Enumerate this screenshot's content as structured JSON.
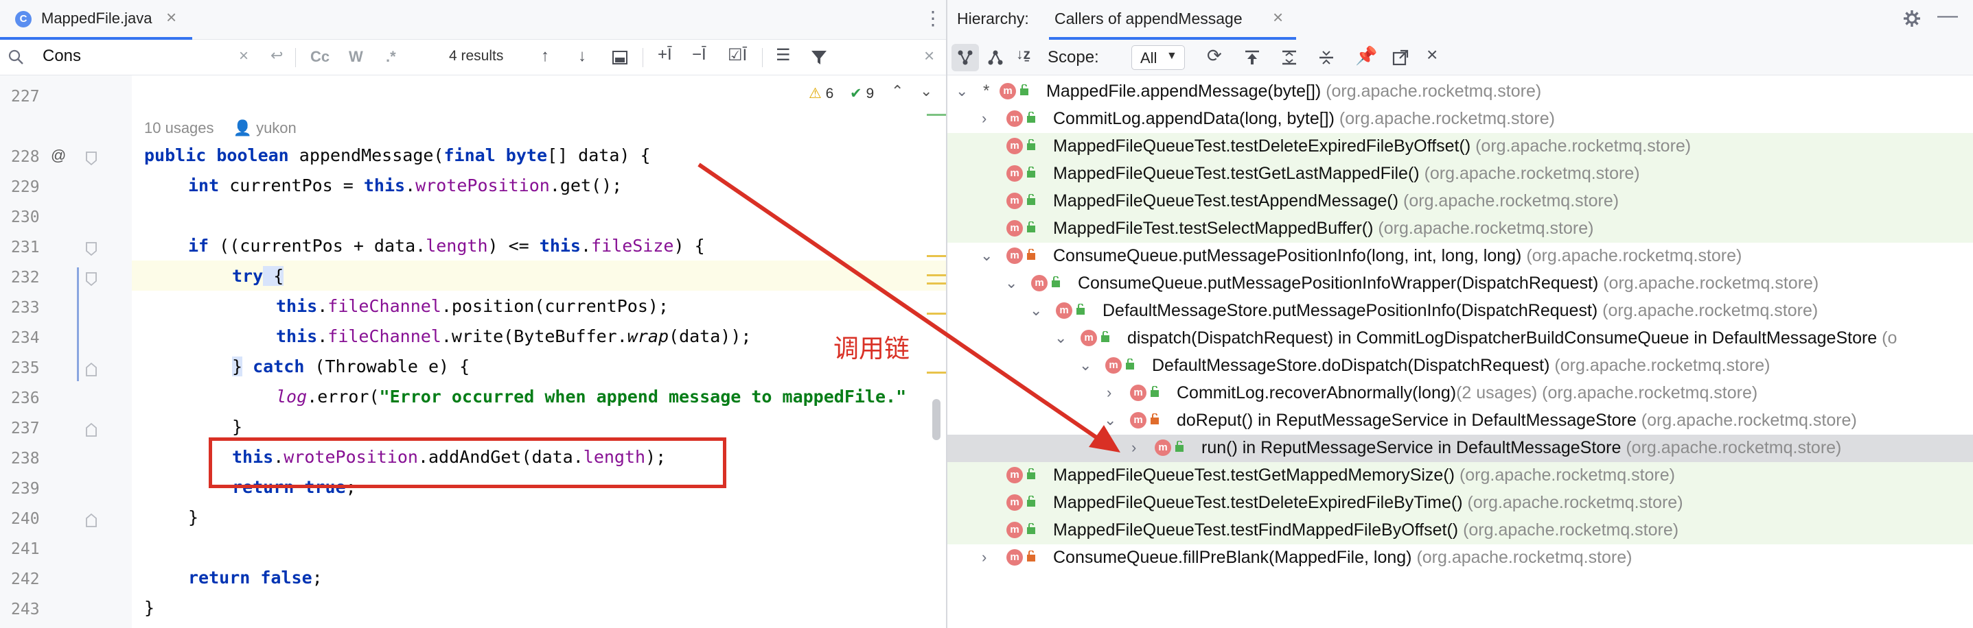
{
  "editor": {
    "tab_label": "MappedFile.java",
    "file_badge": "C",
    "find": {
      "query": "Cons",
      "results": "4 results",
      "cc": "Cc",
      "w": "W",
      "regex": ".*"
    },
    "inspections": {
      "warnings": "6",
      "ok": "9"
    },
    "hint": "10 usages",
    "author": "yukon",
    "lines": [
      "227",
      "228",
      "229",
      "230",
      "231",
      "232",
      "233",
      "234",
      "235",
      "236",
      "237",
      "238",
      "239",
      "240",
      "241",
      "242",
      "243"
    ],
    "code": {
      "l228_a": "public boolean",
      "l228_b": " appendMessage(",
      "l228_c": "final byte",
      "l228_d": "[] data) {",
      "l229_a": "int",
      "l229_b": " currentPos = ",
      "l229_c": "this",
      "l229_d": ".",
      "l229_e": "wrotePosition",
      "l229_f": ".get();",
      "l231_a": "if",
      "l231_b": " ((currentPos + data.",
      "l231_c": "length",
      "l231_d": ") <= ",
      "l231_e": "this",
      "l231_f": ".",
      "l231_g": "fileSize",
      "l231_h": ") {",
      "l232_a": "try",
      "l232_b": " {",
      "l233_a": "this",
      "l233_b": ".",
      "l233_c": "fileChannel",
      "l233_d": ".position(currentPos);",
      "l234_a": "this",
      "l234_b": ".",
      "l234_c": "fileChannel",
      "l234_d": ".write(ByteBuffer.",
      "l234_e": "wrap",
      "l234_f": "(data));",
      "l235_a": "}",
      "l235_b": " catch",
      "l235_c": " (Throwable e) {",
      "l236_a": "log",
      "l236_b": ".error(",
      "l236_c": "\"Error occurred when append message to mappedFile.\"",
      "l237": "}",
      "l238_a": "this",
      "l238_b": ".",
      "l238_c": "wrotePosition",
      "l238_d": ".addAndGet(data.",
      "l238_e": "length",
      "l238_f": ");",
      "l239_a": "return true",
      "l239_b": ";",
      "l240": "}",
      "l242_a": "return false",
      "l242_b": ";",
      "l243": "}"
    }
  },
  "annotation": {
    "label": "调用链",
    "color": "#d93025"
  },
  "hierarchy": {
    "panel_label": "Hierarchy:",
    "tab_label": "Callers of appendMessage",
    "scope_label": "Scope:",
    "scope_value": "All",
    "rows": [
      {
        "name": "MappedFile.appendMessage(byte[])",
        "pkg": "(org.apache.rocketmq.store)"
      },
      {
        "name": "CommitLog.appendData(long, byte[])",
        "pkg": "(org.apache.rocketmq.store)"
      },
      {
        "name": "MappedFileQueueTest.testDeleteExpiredFileByOffset()",
        "pkg": "(org.apache.rocketmq.store)"
      },
      {
        "name": "MappedFileQueueTest.testGetLastMappedFile()",
        "pkg": "(org.apache.rocketmq.store)"
      },
      {
        "name": "MappedFileQueueTest.testAppendMessage()",
        "pkg": "(org.apache.rocketmq.store)"
      },
      {
        "name": "MappedFileTest.testSelectMappedBuffer()",
        "pkg": "(org.apache.rocketmq.store)"
      },
      {
        "name": "ConsumeQueue.putMessagePositionInfo(long, int, long, long)",
        "pkg": "(org.apache.rocketmq.store)"
      },
      {
        "name": "ConsumeQueue.putMessagePositionInfoWrapper(DispatchRequest)",
        "pkg": "(org.apache.rocketmq.store)"
      },
      {
        "name": "DefaultMessageStore.putMessagePositionInfo(DispatchRequest)",
        "pkg": "(org.apache.rocketmq.store)"
      },
      {
        "name": "dispatch(DispatchRequest) in CommitLogDispatcherBuildConsumeQueue in DefaultMessageStore",
        "pkg": "(o"
      },
      {
        "name": "DefaultMessageStore.doDispatch(DispatchRequest)",
        "pkg": "(org.apache.rocketmq.store)"
      },
      {
        "name": "CommitLog.recoverAbnormally(long)",
        "usages": "(2 usages)",
        "pkg": "(org.apache.rocketmq.store)"
      },
      {
        "name": "doReput() in ReputMessageService in DefaultMessageStore",
        "pkg": "(org.apache.rocketmq.store)"
      },
      {
        "name": "run() in ReputMessageService in DefaultMessageStore",
        "pkg": "(org.apache.rocketmq.store)"
      },
      {
        "name": "MappedFileQueueTest.testGetMappedMemorySize()",
        "pkg": "(org.apache.rocketmq.store)"
      },
      {
        "name": "MappedFileQueueTest.testDeleteExpiredFileByTime()",
        "pkg": "(org.apache.rocketmq.store)"
      },
      {
        "name": "MappedFileQueueTest.testFindMappedFileByOffset()",
        "pkg": "(org.apache.rocketmq.store)"
      },
      {
        "name": "ConsumeQueue.fillPreBlank(MappedFile, long)",
        "pkg": "(org.apache.rocketmq.store)"
      }
    ]
  }
}
